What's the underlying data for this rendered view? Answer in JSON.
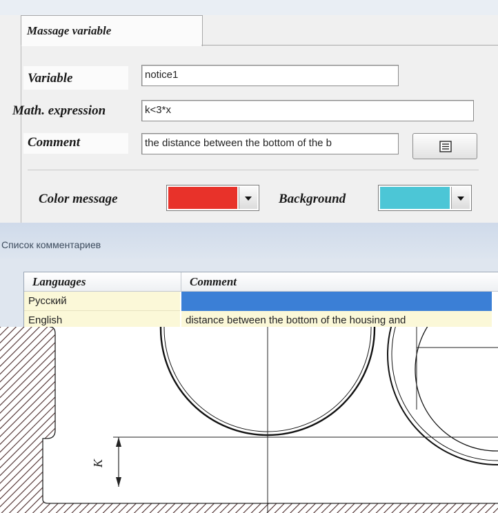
{
  "dialog": {
    "tab_label": "Massage variable",
    "variable": {
      "label": "Variable",
      "value": "notice1"
    },
    "math_expression": {
      "label": "Math. expression",
      "value": "k<3*x"
    },
    "comment": {
      "label": "Comment",
      "value": "the distance between the bottom of the b"
    },
    "color_message": {
      "label": "Color message",
      "color": "#e8322a"
    },
    "background": {
      "label": "Background",
      "color": "#4cc6d6"
    }
  },
  "comments_list": {
    "title": "Список комментариев",
    "columns": [
      "Languages",
      "Comment"
    ],
    "rows": [
      {
        "language": "Русский",
        "comment": ""
      },
      {
        "language": "English",
        "comment": "distance between the bottom of the housing and"
      }
    ],
    "selected_color": "#3b7fd6"
  },
  "drawing": {
    "dimension_label": "K"
  }
}
